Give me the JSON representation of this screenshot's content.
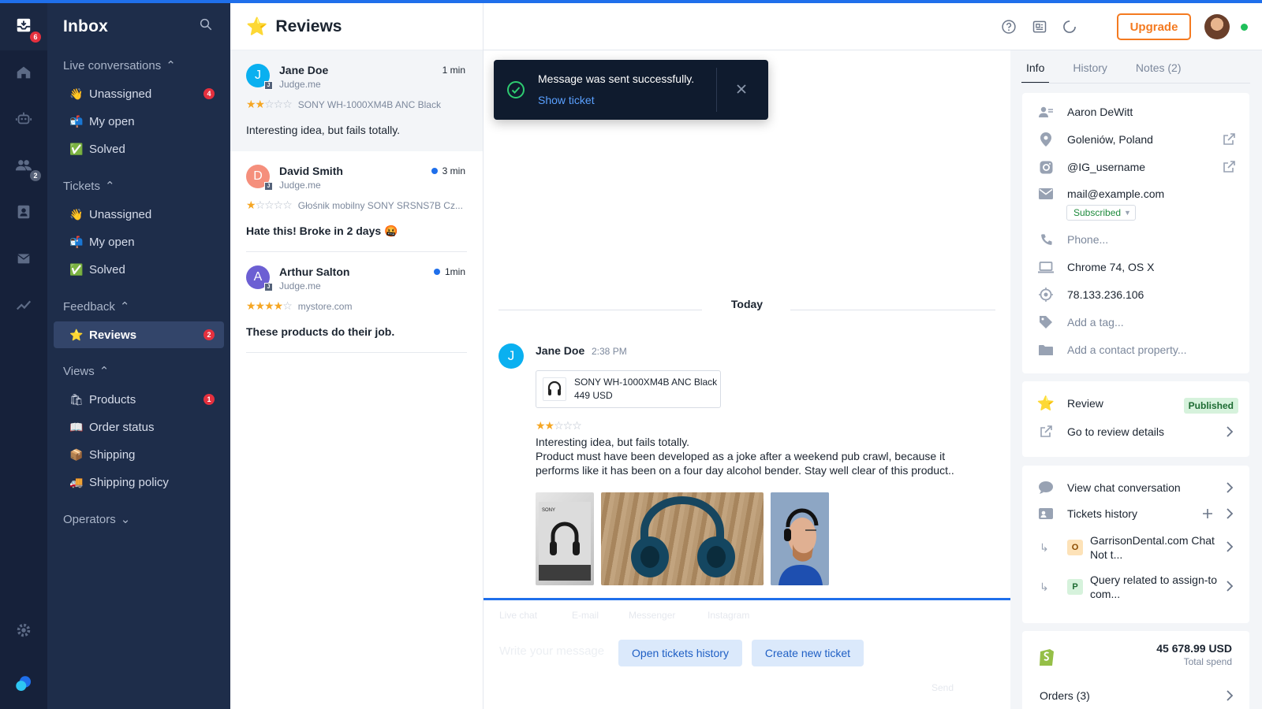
{
  "rail": {
    "inbox_badge": "6",
    "team_badge": "2"
  },
  "sidebar": {
    "title": "Inbox",
    "sections": {
      "live": "Live conversations",
      "tickets": "Tickets",
      "feedback": "Feedback",
      "views": "Views",
      "operators": "Operators"
    },
    "live_items": [
      {
        "label": "Unassigned",
        "badge": "4"
      },
      {
        "label": "My open",
        "badge": ""
      },
      {
        "label": "Solved",
        "badge": ""
      }
    ],
    "ticket_items": [
      {
        "label": "Unassigned"
      },
      {
        "label": "My open"
      },
      {
        "label": "Solved"
      }
    ],
    "feedback_items": [
      {
        "label": "Reviews",
        "badge": "2"
      }
    ],
    "view_items": [
      {
        "label": "Products",
        "badge": "1"
      },
      {
        "label": "Order status"
      },
      {
        "label": "Shipping"
      },
      {
        "label": "Shipping policy"
      }
    ]
  },
  "list": {
    "title": "Reviews",
    "cards": [
      {
        "initial": "J",
        "name": "Jane Doe",
        "source": "Judge.me",
        "source_badge": "J",
        "time": "1 min",
        "unread": false,
        "rating": 2,
        "product": "SONY WH-1000XM4B ANC Black",
        "text": "Interesting idea, but fails totally."
      },
      {
        "initial": "D",
        "name": "David Smith",
        "source": "Judge.me",
        "source_badge": "J",
        "time": "3 min",
        "unread": true,
        "rating": 1,
        "product": "Głośnik mobilny SONY SRSNS7B Cz...",
        "text": "Hate this! Broke in 2 days 🤬"
      },
      {
        "initial": "A",
        "name": "Arthur Salton",
        "source": "Judge.me",
        "source_badge": "J",
        "time": "1min",
        "unread": true,
        "rating": 4,
        "product": "mystore.com",
        "text": "These products do their job."
      }
    ]
  },
  "topbar": {
    "upgrade_label": "Upgrade"
  },
  "toast": {
    "message": "Message was sent successfully.",
    "link": "Show ticket"
  },
  "conversation": {
    "day": "Today",
    "author_initial": "J",
    "author": "Jane Doe",
    "time": "2:38 PM",
    "product_name": "SONY WH-1000XM4B ANC Black",
    "product_price": "449 USD",
    "rating": 2,
    "headline": "Interesting idea, but fails totally.",
    "body": "Product must have been developed as a joke after a weekend pub crawl, because it performs like it has been on a four day alcohol bender. Stay well clear of this product..",
    "photos": [
      "headphones-box-photo",
      "headphones-on-wood-photo",
      "man-wearing-headphones-photo"
    ]
  },
  "composer": {
    "tabs": [
      "Live chat",
      "E-mail",
      "Messenger",
      "Instagram"
    ],
    "placeholder": "Write your message",
    "open_history": "Open tickets history",
    "create_ticket": "Create new ticket",
    "send": "Send"
  },
  "panel": {
    "tabs": [
      "Info",
      "History",
      "Notes (2)"
    ],
    "contact": {
      "name": "Aaron DeWitt",
      "location": "Goleniów, Poland",
      "instagram": "@IG_username",
      "email": "mail@example.com",
      "subscription": "Subscribed",
      "phone": "Phone...",
      "browser": "Chrome 74, OS X",
      "ip": "78.133.236.106",
      "add_tag": "Add a tag...",
      "add_property": "Add a contact property..."
    },
    "review": {
      "label": "Review",
      "status": "Published",
      "details": "Go to review details"
    },
    "links": {
      "chat": "View chat conversation",
      "tickets_history": "Tickets history"
    },
    "tickets": [
      {
        "tag": "O",
        "title": "GarrisonDental.com Chat Not t...",
        "color": "#fde2b8",
        "text_color": "#8a4b00"
      },
      {
        "tag": "P",
        "title": "Query related to assign-to com...",
        "color": "#d6f2dc",
        "text_color": "#1d6b32"
      }
    ],
    "shop": {
      "amount": "45 678.99 USD",
      "label": "Total spend",
      "orders": "Orders (3)"
    }
  },
  "colors": {
    "accent": "#1f6feb",
    "upgrade": "#f47a20",
    "star": "#f5a623",
    "rail": "#16213a",
    "sidebar": "#1e2d4a"
  }
}
